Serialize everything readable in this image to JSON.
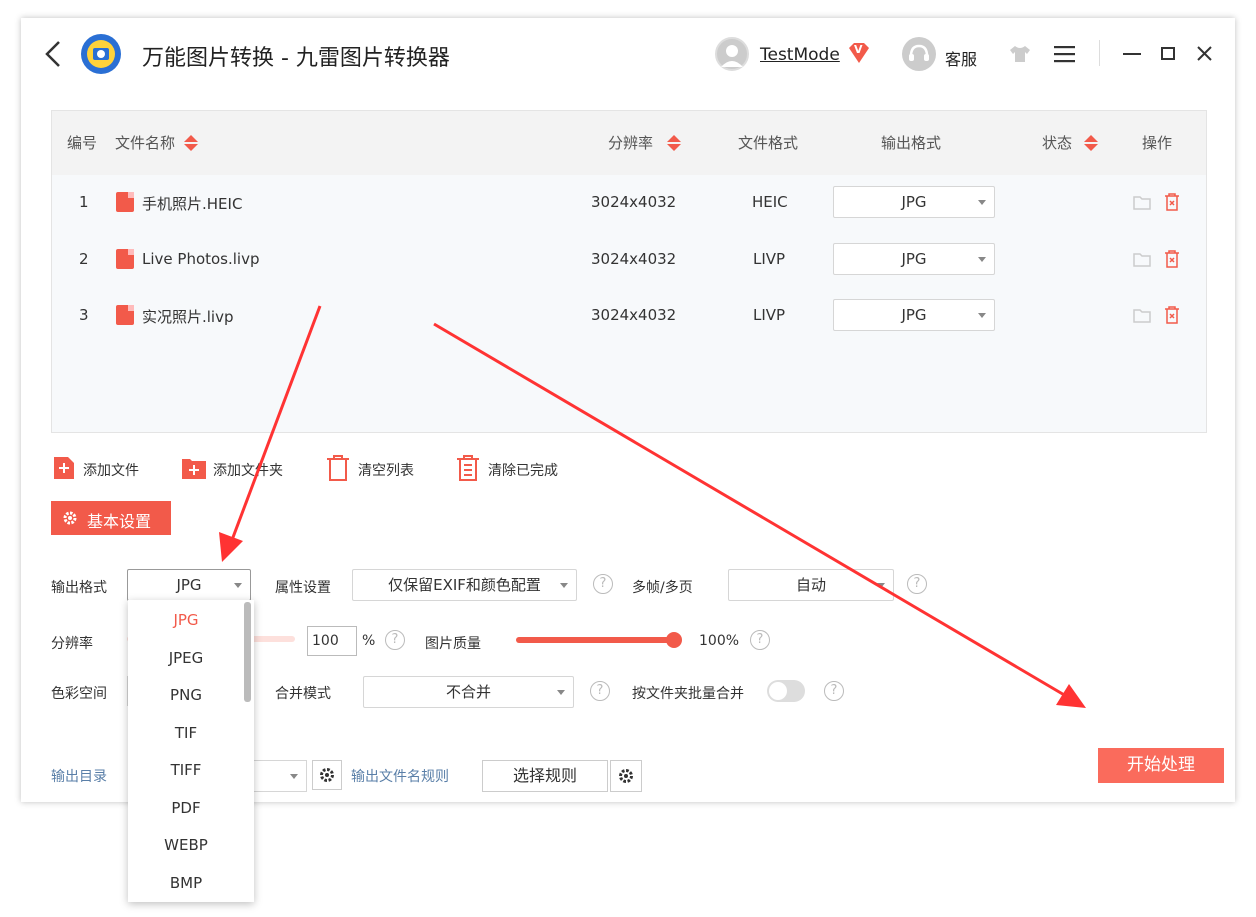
{
  "app": {
    "title": "万能图片转换 - 九雷图片转换器",
    "user": "TestMode",
    "vip_badge": "V",
    "support": "客服"
  },
  "table": {
    "headers": [
      "编号",
      "文件名称",
      "分辨率",
      "文件格式",
      "输出格式",
      "状态",
      "操作"
    ],
    "rows": [
      {
        "no": "1",
        "name": "手机照片.HEIC",
        "resolution": "3024x4032",
        "format": "HEIC",
        "output": "JPG"
      },
      {
        "no": "2",
        "name": "Live Photos.livp",
        "resolution": "3024x4032",
        "format": "LIVP",
        "output": "JPG"
      },
      {
        "no": "3",
        "name": "实况照片.livp",
        "resolution": "3024x4032",
        "format": "LIVP",
        "output": "JPG"
      }
    ]
  },
  "toolbar": {
    "add_file": "添加文件",
    "add_folder": "添加文件夹",
    "clear_list": "清空列表",
    "clear_done": "清除已完成"
  },
  "settings": {
    "tab_label": "基本设置",
    "output_format_label": "输出格式",
    "output_format_value": "JPG",
    "attr_label": "属性设置",
    "attr_value": "仅保留EXIF和颜色配置",
    "multiframe_label": "多帧/多页",
    "multiframe_value": "自动",
    "resolution_label": "分辨率",
    "resolution_value": "100",
    "resolution_unit": "%",
    "quality_label": "图片质量",
    "quality_value": "100%",
    "quality_fraction": 1.0,
    "color_space_label": "色彩空间",
    "merge_label": "合并模式",
    "merge_value": "不合并",
    "batch_merge_label": "按文件夹批量合并",
    "output_dir_label": "输出目录",
    "filename_rule_label": "输出文件名规则",
    "select_rule_button": "选择规则",
    "start_button": "开始处理",
    "help_symbol": "?"
  },
  "format_dropdown": {
    "selected": "JPG",
    "options": [
      "JPG",
      "JPEG",
      "PNG",
      "TIF",
      "TIFF",
      "PDF",
      "WEBP",
      "BMP"
    ]
  },
  "colors": {
    "accent": "#f25a4a",
    "start_button": "#fa6b5c",
    "annotation_arrow": "#ff3333"
  }
}
